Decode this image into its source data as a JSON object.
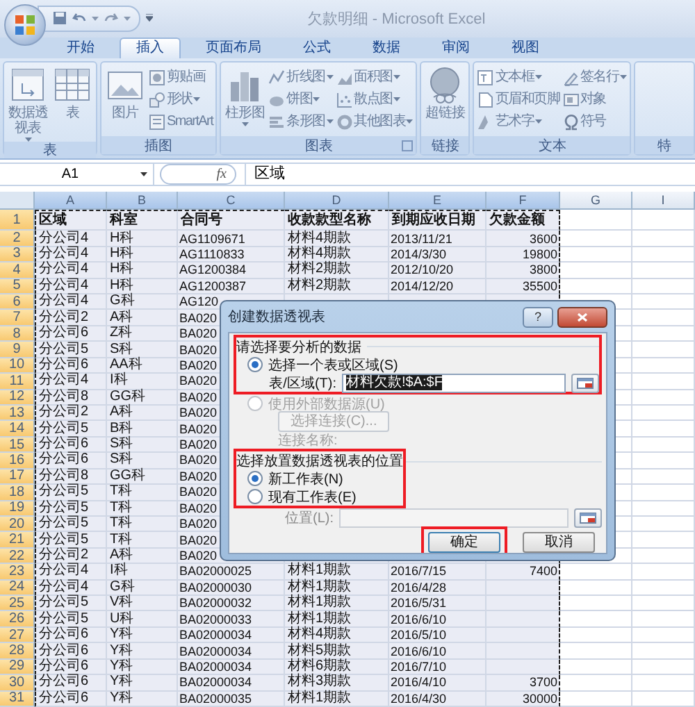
{
  "window": {
    "title": "欠款明细 - Microsoft Excel"
  },
  "tabs": [
    {
      "label": "开始",
      "selected": false
    },
    {
      "label": "插入",
      "selected": true
    },
    {
      "label": "页面布局",
      "selected": false
    },
    {
      "label": "公式",
      "selected": false
    },
    {
      "label": "数据",
      "selected": false
    },
    {
      "label": "审阅",
      "selected": false
    },
    {
      "label": "视图",
      "selected": false
    }
  ],
  "ribbon": [
    {
      "label": "表",
      "items": [
        {
          "kind": "large",
          "label": "数据透视表",
          "menu": true
        },
        {
          "kind": "large",
          "label": "表",
          "menu": false
        }
      ]
    },
    {
      "label": "插图",
      "items": [
        {
          "kind": "large",
          "label": "图片",
          "menu": false
        },
        {
          "kind": "small",
          "label": "剪贴画",
          "menu": false
        },
        {
          "kind": "small",
          "label": "形状",
          "menu": true
        },
        {
          "kind": "small",
          "label": "SmartArt",
          "menu": false
        }
      ]
    },
    {
      "label": "图表",
      "launcher": true,
      "items": [
        {
          "kind": "large",
          "label": "柱形图",
          "menu": true
        },
        {
          "kind": "small",
          "label": "折线图",
          "menu": true
        },
        {
          "kind": "small",
          "label": "饼图",
          "menu": true
        },
        {
          "kind": "small",
          "label": "条形图",
          "menu": true
        },
        {
          "kind": "small",
          "label": "面积图",
          "menu": true
        },
        {
          "kind": "small",
          "label": "散点图",
          "menu": true
        },
        {
          "kind": "small",
          "label": "其他图表",
          "menu": true
        }
      ]
    },
    {
      "label": "链接",
      "items": [
        {
          "kind": "large",
          "label": "超链接",
          "menu": false
        }
      ]
    },
    {
      "label": "文本",
      "items": [
        {
          "kind": "small",
          "label": "文本框",
          "menu": true
        },
        {
          "kind": "small",
          "label": "页眉和页脚",
          "menu": false
        },
        {
          "kind": "small",
          "label": "艺术字",
          "menu": true
        },
        {
          "kind": "small",
          "label": "签名行",
          "menu": true
        },
        {
          "kind": "small",
          "label": "对象",
          "menu": false
        },
        {
          "kind": "small",
          "label": "符号",
          "menu": false
        }
      ]
    },
    {
      "label": "特"
    }
  ],
  "formula_bar": {
    "name_box": "A1",
    "function_label": "fx",
    "value": "区域"
  },
  "columns": [
    {
      "letter": "A",
      "selected": true,
      "kind": "text"
    },
    {
      "letter": "B",
      "selected": true,
      "kind": "text"
    },
    {
      "letter": "C",
      "selected": true,
      "kind": "text"
    },
    {
      "letter": "D",
      "selected": true,
      "kind": "text"
    },
    {
      "letter": "E",
      "selected": true,
      "kind": "text"
    },
    {
      "letter": "F",
      "selected": true,
      "kind": "number"
    },
    {
      "letter": "G",
      "selected": false,
      "kind": "text"
    },
    {
      "letter": "I",
      "selected": false,
      "kind": "text"
    }
  ],
  "rows": [
    {
      "number": "1",
      "header": true,
      "cells": [
        "区域",
        "科室",
        "合同号",
        "收款款型名称",
        "到期应收日期",
        "欠款金额"
      ]
    },
    {
      "number": "2",
      "cells": [
        "分公司4",
        "H科",
        "AG1109671",
        "材料4期款",
        "2013/11/21",
        "3600"
      ]
    },
    {
      "number": "3",
      "cells": [
        "分公司4",
        "H科",
        "AG1110833",
        "材料4期款",
        "2014/3/30",
        "19800"
      ]
    },
    {
      "number": "4",
      "cells": [
        "分公司4",
        "H科",
        "AG1200384",
        "材料2期款",
        "2012/10/20",
        "3800"
      ]
    },
    {
      "number": "5",
      "cells": [
        "分公司4",
        "H科",
        "AG1200387",
        "材料2期款",
        "2014/12/20",
        "35500"
      ]
    },
    {
      "number": "6",
      "cells": [
        "分公司4",
        "G科",
        "AG120"
      ]
    },
    {
      "number": "7",
      "cells": [
        "分公司2",
        "A科",
        "BA020"
      ]
    },
    {
      "number": "8",
      "cells": [
        "分公司6",
        "Z科",
        "BA020"
      ]
    },
    {
      "number": "9",
      "cells": [
        "分公司5",
        "S科",
        "BA020"
      ]
    },
    {
      "number": "10",
      "cells": [
        "分公司6",
        "AA科",
        "BA020"
      ]
    },
    {
      "number": "11",
      "cells": [
        "分公司4",
        "I科",
        "BA020"
      ]
    },
    {
      "number": "12",
      "cells": [
        "分公司8",
        "GG科",
        "BA020"
      ]
    },
    {
      "number": "13",
      "cells": [
        "分公司2",
        "A科",
        "BA020"
      ]
    },
    {
      "number": "14",
      "cells": [
        "分公司5",
        "B科",
        "BA020"
      ]
    },
    {
      "number": "15",
      "cells": [
        "分公司6",
        "S科",
        "BA020"
      ]
    },
    {
      "number": "16",
      "cells": [
        "分公司6",
        "S科",
        "BA020"
      ]
    },
    {
      "number": "17",
      "cells": [
        "分公司8",
        "GG科",
        "BA020"
      ]
    },
    {
      "number": "18",
      "cells": [
        "分公司5",
        "T科",
        "BA020"
      ]
    },
    {
      "number": "19",
      "cells": [
        "分公司5",
        "T科",
        "BA020"
      ]
    },
    {
      "number": "20",
      "cells": [
        "分公司5",
        "T科",
        "BA020"
      ]
    },
    {
      "number": "21",
      "cells": [
        "分公司5",
        "T科",
        "BA020"
      ]
    },
    {
      "number": "22",
      "cells": [
        "分公司2",
        "A科",
        "BA020"
      ]
    },
    {
      "number": "23",
      "cells": [
        "分公司4",
        "I科",
        "BA02000025",
        "材料1期款",
        "2016/7/15",
        "7400"
      ]
    },
    {
      "number": "24",
      "cells": [
        "分公司4",
        "G科",
        "BA02000030",
        "材料1期款",
        "2016/4/28"
      ]
    },
    {
      "number": "25",
      "cells": [
        "分公司5",
        "V科",
        "BA02000032",
        "材料1期款",
        "2016/5/31"
      ]
    },
    {
      "number": "26",
      "cells": [
        "分公司5",
        "U科",
        "BA02000033",
        "材料1期款",
        "2016/6/10"
      ]
    },
    {
      "number": "27",
      "cells": [
        "分公司6",
        "Y科",
        "BA02000034",
        "材料4期款",
        "2016/5/10"
      ]
    },
    {
      "number": "28",
      "cells": [
        "分公司6",
        "Y科",
        "BA02000034",
        "材料5期款",
        "2016/6/10"
      ]
    },
    {
      "number": "29",
      "cells": [
        "分公司6",
        "Y科",
        "BA02000034",
        "材料6期款",
        "2016/7/10"
      ]
    },
    {
      "number": "30",
      "cells": [
        "分公司6",
        "Y科",
        "BA02000034",
        "材料3期款",
        "2016/4/10",
        "3700"
      ]
    },
    {
      "number": "31",
      "cells": [
        "分公司6",
        "Y科",
        "BA02000035",
        "材料1期款",
        "2016/4/30",
        "30000"
      ]
    }
  ],
  "dialog": {
    "title": "创建数据透视表",
    "help": "?",
    "sections": [
      {
        "heading": "请选择要分析的数据",
        "highlighted": true,
        "options": [
          {
            "label": "选择一个表或区域(S)",
            "selected": true,
            "disabled": false,
            "field": {
              "label": "表/区域(T):",
              "value": "材料欠款!$A:$F",
              "value_selected": true
            }
          },
          {
            "label": "使用外部数据源(U)",
            "selected": false,
            "disabled": true,
            "button": "选择连接(C)...",
            "note": "连接名称:"
          }
        ]
      },
      {
        "heading": "选择放置数据透视表的位置",
        "highlighted": true,
        "options": [
          {
            "label": "新工作表(N)",
            "selected": true,
            "disabled": false
          },
          {
            "label": "现有工作表(E)",
            "selected": false,
            "disabled": false
          }
        ],
        "field": {
          "label": "位置(L):",
          "disabled": true
        }
      }
    ],
    "buttons": [
      {
        "label": "确定",
        "highlighted": true,
        "default": true
      },
      {
        "label": "取消",
        "highlighted": false,
        "default": false
      }
    ]
  }
}
